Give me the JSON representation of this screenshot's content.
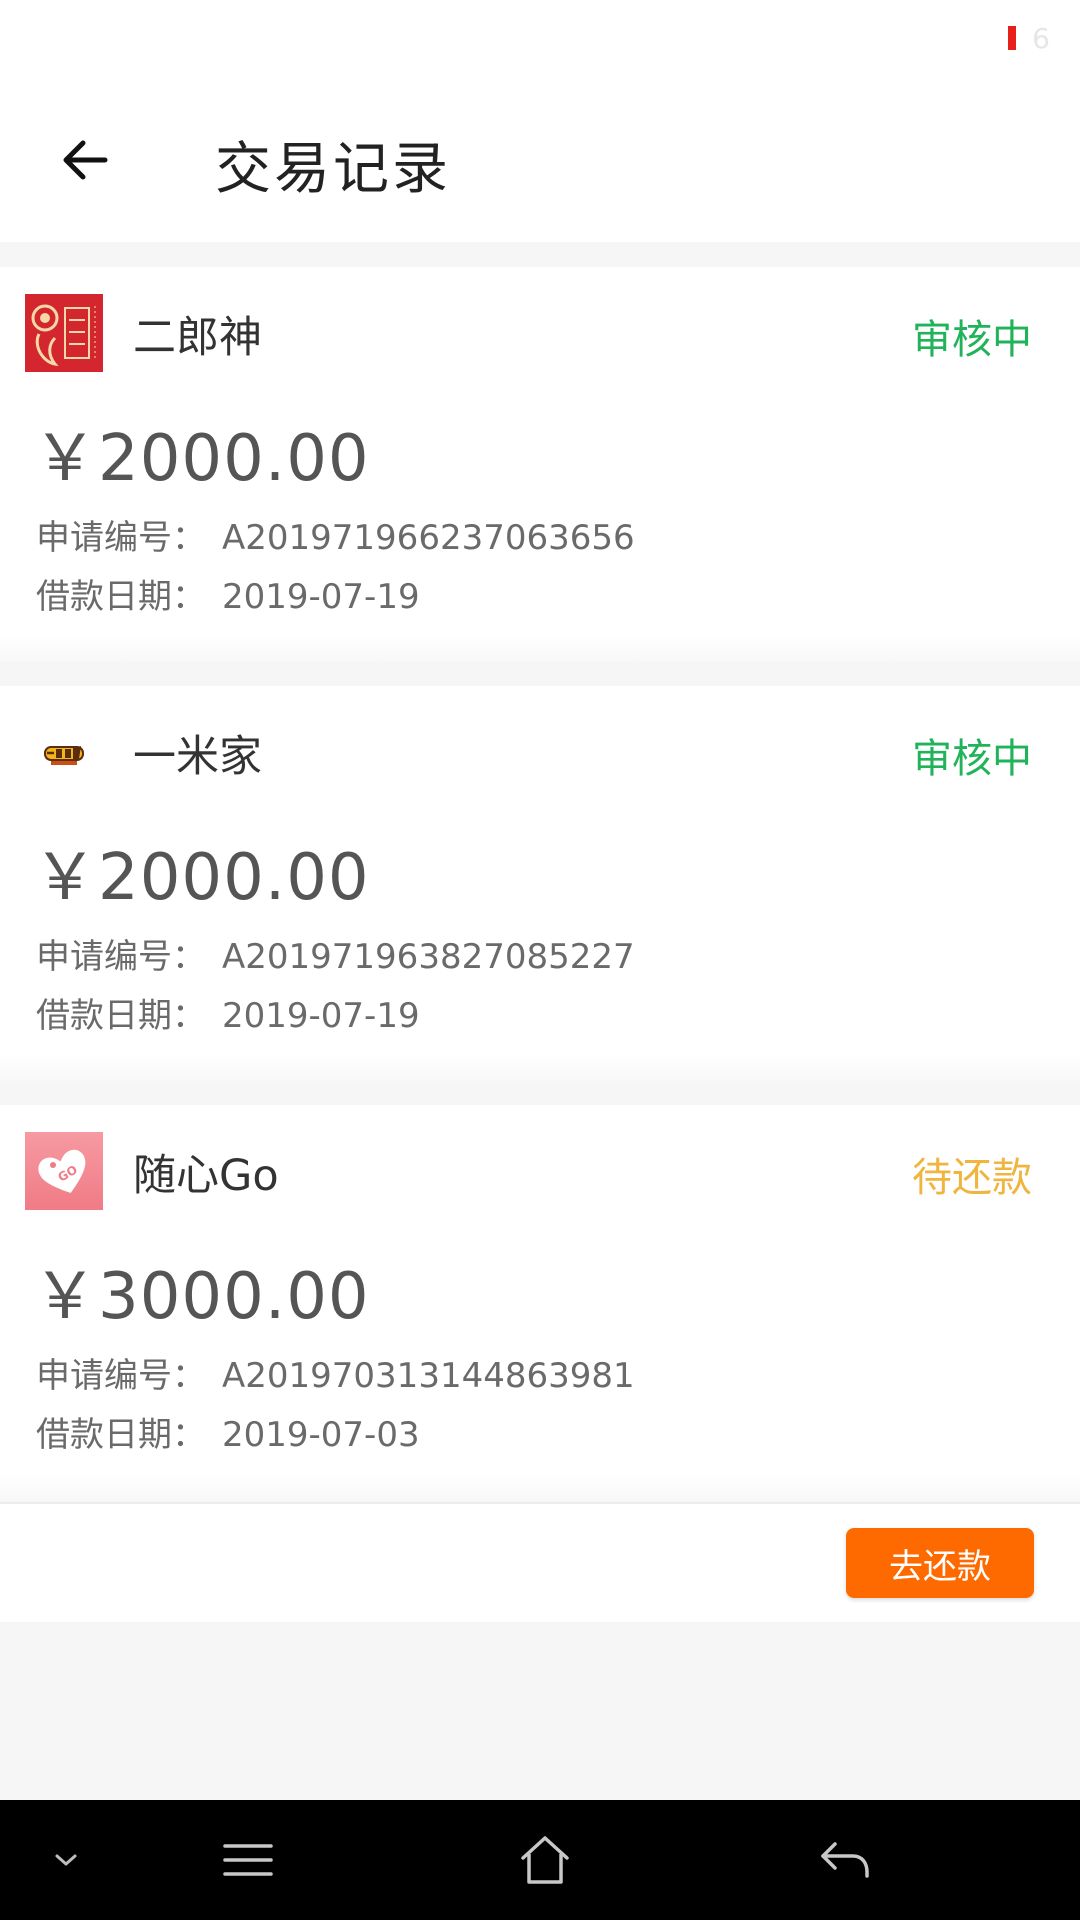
{
  "status_bar": {
    "indicator_color": "#e8201c",
    "text": "6"
  },
  "header": {
    "back_icon": "back-arrow-icon",
    "title": "交易记录"
  },
  "records": [
    {
      "merchant": "二郎神",
      "logo_icon": "erlangshen-logo-icon",
      "status": "审核中",
      "status_color": "#21b35a",
      "amount": "￥2000.00",
      "id_label": "申请编号：",
      "id_value": "A201971966237063656",
      "date_label": "借款日期：",
      "date_value": "2019-07-19"
    },
    {
      "merchant": "一米家",
      "logo_icon": "yimijia-logo-icon",
      "status": "审核中",
      "status_color": "#21b35a",
      "amount": "￥2000.00",
      "id_label": "申请编号：",
      "id_value": "A201971963827085227",
      "date_label": "借款日期：",
      "date_value": "2019-07-19"
    },
    {
      "merchant": "随心Go",
      "logo_icon": "suixingo-logo-icon",
      "status": "待还款",
      "status_color": "#f0b53f",
      "amount": "￥3000.00",
      "id_label": "申请编号：",
      "id_value": "A201970313144863981",
      "date_label": "借款日期：",
      "date_value": "2019-07-03"
    }
  ],
  "repay_button": {
    "label": "去还款",
    "color": "#ff6a00"
  },
  "nav_bar": {
    "icons": [
      "chevron-down-icon",
      "menu-icon",
      "home-icon",
      "back-icon"
    ]
  }
}
